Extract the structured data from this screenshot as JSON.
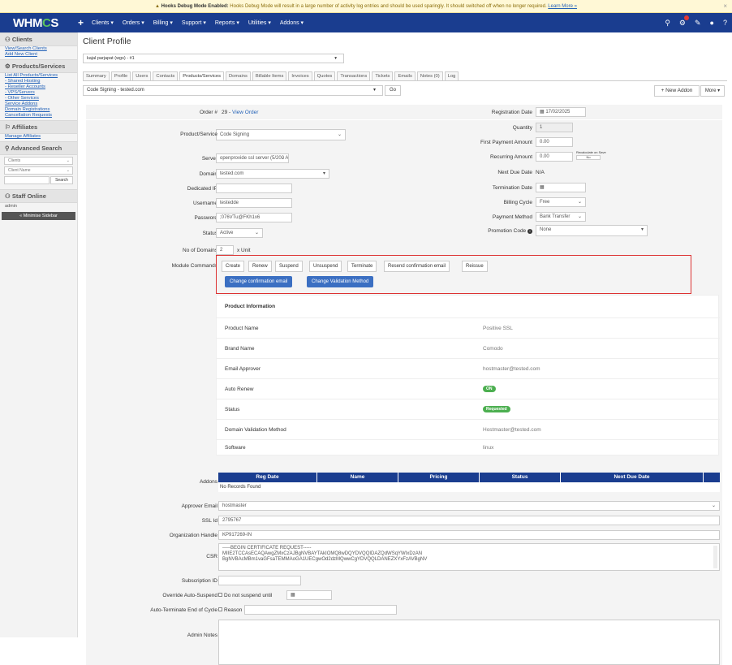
{
  "notice": {
    "bold": "Hooks Debug Mode Enabled:",
    "text": " Hooks Debug Mode will result in a large number of activity log entries and should be used sparingly. It should switched off when no longer required.",
    "link": "Learn More »",
    "close": "×"
  },
  "logo": {
    "a": "WHM",
    "b": "C",
    "c": "S"
  },
  "nav": {
    "plus": "+",
    "items": [
      "Clients ▾",
      "Orders ▾",
      "Billing ▾",
      "Support ▾",
      "Reports ▾",
      "Utilities ▾",
      "Addons ▾"
    ]
  },
  "sidebar": {
    "clients_head": "Clients",
    "clients_links": [
      "View/Search Clients",
      "Add New Client"
    ],
    "products_head": "Products/Services",
    "products_links": [
      "List All Products/Services",
      "- Shared Hosting",
      "- Reseller Accounts",
      "- VPS/Servers",
      "- Other Services",
      "Service Addons",
      "Domain Registrations",
      "Cancellation Requests"
    ],
    "affiliates_head": "Affiliates",
    "affiliates_links": [
      "Manage Affiliates"
    ],
    "search_head": "Advanced Search",
    "search_type": "Clients",
    "search_field": "Client Name",
    "search_button": "Search",
    "staff_head": "Staff Online",
    "staff_user": "admin",
    "minimise": "« Minimise Sidebar"
  },
  "page": {
    "title": "Client Profile",
    "client": "kajal parjapat (wgs) - #1",
    "tabs": [
      "Summary",
      "Profile",
      "Users",
      "Contacts",
      "Products/Services",
      "Domains",
      "Billable Items",
      "Invoices",
      "Quotes",
      "Transactions",
      "Tickets",
      "Emails",
      "Notes (0)",
      "Log"
    ],
    "product_select": "Code Signing - tested.com",
    "go": "Go",
    "new_addon": "+ New Addon",
    "more": "More ▾"
  },
  "form": {
    "order_label": "Order #",
    "order_val": "29 - ",
    "order_link": "View Order",
    "product_label": "Product/Service",
    "product_val": "Code Signing",
    "server_label": "Server",
    "server_val": "openprovide ssl server (5/200 A",
    "domain_label": "Domain",
    "domain_val": "tested.com",
    "ip_label": "Dedicated IP",
    "user_label": "Username",
    "user_val": "testedde",
    "pass_label": "Password",
    "pass_val": ";076VTu@FKh1x6",
    "status_label": "Status",
    "status_val": "Active",
    "nodomains_label": "No of Domains",
    "nodomains_val": "2",
    "nodomains_unit": "x Unit",
    "regdate_label": "Registration Date",
    "regdate_val": "17/02/2025",
    "qty_label": "Quantity",
    "qty_val": "1",
    "fpa_label": "First Payment Amount",
    "fpa_val": "0.00",
    "ra_label": "Recurring Amount",
    "ra_val": "0.00",
    "recalc": "Recalculate on Save",
    "recalc_no": "No",
    "nextdue_label": "Next Due Date",
    "nextdue_val": "N/A",
    "term_label": "Termination Date",
    "cycle_label": "Billing Cycle",
    "cycle_val": "Free",
    "paym_label": "Payment Method",
    "paym_val": "Bank Transfer",
    "promo_label": "Promotion Code",
    "promo_val": "None",
    "module_label": "Module Commands"
  },
  "module_buttons": [
    "Create",
    "Renew",
    "Suspend",
    "Unsuspend",
    "Terminate",
    "Resend confirmation email",
    "Reissue"
  ],
  "primary_buttons": [
    "Change confirmation email",
    "Change Validation Method"
  ],
  "product_info": {
    "title": "Product Information",
    "rows": [
      {
        "k": "Product Name",
        "v": "Positive SSL"
      },
      {
        "k": "Brand Name",
        "v": "Comodo"
      },
      {
        "k": "Email Approver",
        "v": "hostmaster@tested.com"
      },
      {
        "k": "Auto Renew",
        "v": "ON"
      },
      {
        "k": "Status",
        "v": "Requested"
      },
      {
        "k": "Domain Validation Method",
        "v": "Hostmaster@tested.com"
      },
      {
        "k": "Software",
        "v": "linux"
      }
    ]
  },
  "addons": {
    "label": "Addons",
    "cols": [
      "Reg Date",
      "Name",
      "Pricing",
      "Status",
      "Next Due Date"
    ],
    "empty": "No Records Found"
  },
  "lower": {
    "approver_label": "Approver Email",
    "approver_val": "hostmaster",
    "sslid_label": "SSL Id",
    "sslid_val": "2795767",
    "org_label": "Organization Handle",
    "org_val": "KP917269-IN",
    "csr_label": "CSR",
    "csr_l1": "-----BEGIN CERTIFICATE REQUEST-----",
    "csr_l2": "MIIE2TCCAsECAQAwgZMxCzAJBgNVBAYTAkIOMQ8wDQYDVQQIDAZQdWSqYWIxDzAN",
    "csr_l3": "BgNVBAcMBm1vaGFsaTEMMAoGA1UECgwOd2dzMQwwCgYDVQQLDANEZXYxFzAVBgNV",
    "subid_label": "Subscription ID",
    "override_label": "Override Auto-Suspend",
    "override_val": "Do not suspend until",
    "autoterm_label": "Auto-Terminate End of Cycle",
    "autoterm_val": "Reason",
    "notes_label": "Admin Notes"
  }
}
